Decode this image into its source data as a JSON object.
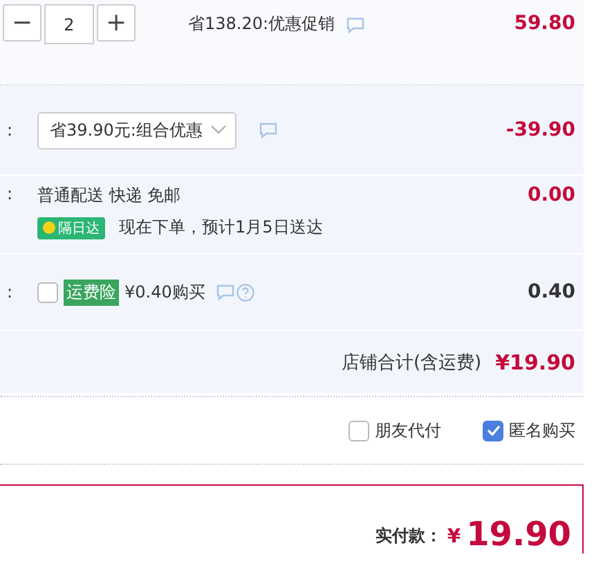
{
  "item_row": {
    "quantity": {
      "minus": "−",
      "value": "2",
      "plus": "+"
    },
    "promotion": "省138.20:优惠促销",
    "price": "59.80"
  },
  "discount_row": {
    "label": ":",
    "select_value": "省39.90元:组合优惠",
    "amount": "-39.90"
  },
  "delivery_row": {
    "label": ":",
    "method": "普通配送 快递 免邮",
    "badge": "隔日达",
    "estimate": "现在下单，预计1月5日送达",
    "amount": "0.00"
  },
  "insurance_row": {
    "label": ":",
    "checked": false,
    "tag": "运费险",
    "offer": "¥0.40购买",
    "amount": "0.40"
  },
  "shop_total": {
    "label": "店铺合计(含运费)",
    "amount": "¥19.90"
  },
  "options": [
    {
      "label": "朋友代付",
      "checked": false
    },
    {
      "label": "匿名购买",
      "checked": true
    }
  ],
  "payment": {
    "label": "实付款：",
    "currency": "¥",
    "amount": "19.90"
  }
}
